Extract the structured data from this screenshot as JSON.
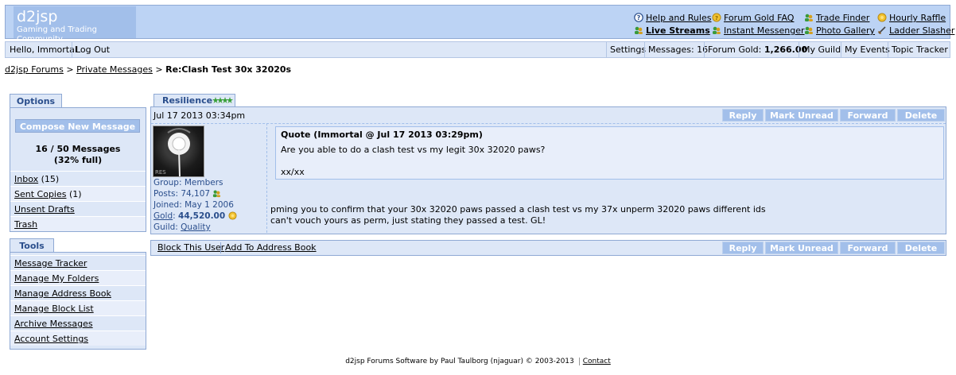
{
  "header": {
    "site_title": "d2jsp",
    "site_subtitle": "Gaming and Trading Community",
    "links": {
      "help": "Help and Rules",
      "faq": "Forum Gold FAQ",
      "trade": "Trade Finder",
      "raffle": "Hourly Raffle",
      "streams": "Live Streams",
      "im": "Instant Messenger",
      "gallery": "Photo Gallery",
      "ladder": "Ladder Slasher"
    }
  },
  "userbar": {
    "greeting": "Hello, Immortal",
    "logout": "Log Out",
    "settings": "Settings",
    "messages": "Messages: 16",
    "gold_label": "Forum Gold: ",
    "gold_value": "1,266.00",
    "guild": "My Guild",
    "events": "My Events",
    "tracker": "Topic Tracker"
  },
  "breadcrumb": {
    "home": "d2jsp Forums",
    "sep1": " > ",
    "pm": "Private Messages",
    "sep2": " > ",
    "current": "Re:Clash Test 30x 32020s"
  },
  "options": {
    "tab": "Options",
    "compose": "Compose New Message",
    "count": "16 / 50 Messages",
    "percent": "(32% full)",
    "inbox_label": "Inbox",
    "inbox_count": " (15)",
    "sent_label": "Sent Copies",
    "sent_count": " (1)",
    "drafts": "Unsent Drafts",
    "trash": "Trash"
  },
  "tools": {
    "tab": "Tools",
    "items": [
      "Message Tracker",
      "Manage My Folders",
      "Manage Address Book",
      "Manage Block List",
      "Archive Messages",
      "Account Settings"
    ]
  },
  "message": {
    "author": "Resilience",
    "date": "Jul 17 2013 03:34pm",
    "actions": {
      "reply": "Reply",
      "unread": "Mark Unread",
      "forward": "Forward",
      "delete": "Delete"
    },
    "user": {
      "avatar_text": "RES",
      "group": "Group: Members",
      "posts": "Posts: 74,107",
      "joined": "Joined: May 1 2006",
      "gold_label": "Gold",
      "gold_value": "44,520.00",
      "guild_label": "Guild: ",
      "guild_value": "Quality"
    },
    "quote": {
      "head": "Quote (Immortal @ Jul 17 2013 03:29pm)",
      "line1": "Are you able to do a clash test vs my legit 30x 32020 paws?",
      "line2": "xx/xx"
    },
    "body": {
      "line1": "pming you to confirm that your 30x 32020 paws passed a clash test vs my 37x unperm 32020 paws different ids",
      "line2": "can't vouch yours as perm, just stating they passed a test. GL!"
    }
  },
  "footbar": {
    "block": "Block This User",
    "address": "Add To Address Book"
  },
  "footer": {
    "text": "d2jsp Forums Software by Paul Taulborg (njaguar) © 2003-2013",
    "contact": "Contact"
  },
  "colors": {
    "header_bg": "#bcd3f4",
    "panel_bg": "#dde7f7",
    "button_bg": "#a2bfea",
    "accent_text": "#2a4e8c"
  }
}
